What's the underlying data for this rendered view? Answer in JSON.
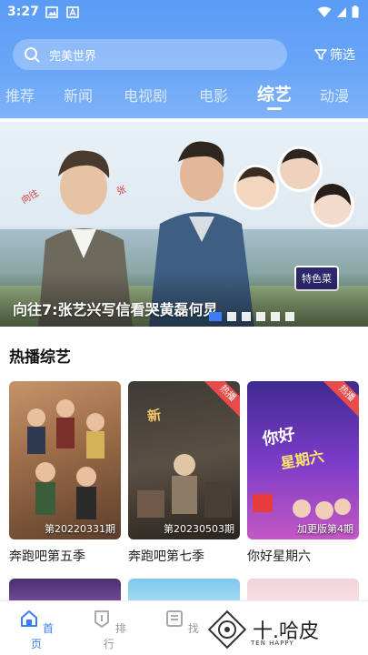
{
  "status_bar": {
    "time": "3:27"
  },
  "search": {
    "placeholder": "完美世界",
    "filter_label": "筛选"
  },
  "tabs": [
    {
      "label": "推荐",
      "active": false
    },
    {
      "label": "新闻",
      "active": false
    },
    {
      "label": "电视剧",
      "active": false
    },
    {
      "label": "电影",
      "active": false
    },
    {
      "label": "综艺",
      "active": true
    },
    {
      "label": "动漫",
      "active": false
    }
  ],
  "banner": {
    "caption": "向往7:张艺兴写信看哭黄磊何炅",
    "badge": "特色菜",
    "slide_count": 6,
    "active_slide": 1
  },
  "section": {
    "title": "热播综艺"
  },
  "cards": [
    {
      "name": "奔跑吧第五季",
      "episode": "第20220331期",
      "hot": false
    },
    {
      "name": "奔跑吧第七季",
      "episode": "第20230503期",
      "hot": true,
      "hot_label": "热播"
    },
    {
      "name": "你好星期六",
      "episode": "加更版第4期",
      "hot": true,
      "hot_label": "热播"
    }
  ],
  "bottom_nav": [
    {
      "label": "首页",
      "icon": "home-icon",
      "active": true
    },
    {
      "label": "排行",
      "icon": "rank-icon",
      "active": false
    },
    {
      "label": "找",
      "icon": "find-icon",
      "active": false
    }
  ],
  "watermark": {
    "text": "十.哈皮",
    "sub": "TEN HAPPY"
  },
  "colors": {
    "accent": "#3c7ef2",
    "header": "#5a9cf6",
    "hot": "#e94b4b"
  }
}
